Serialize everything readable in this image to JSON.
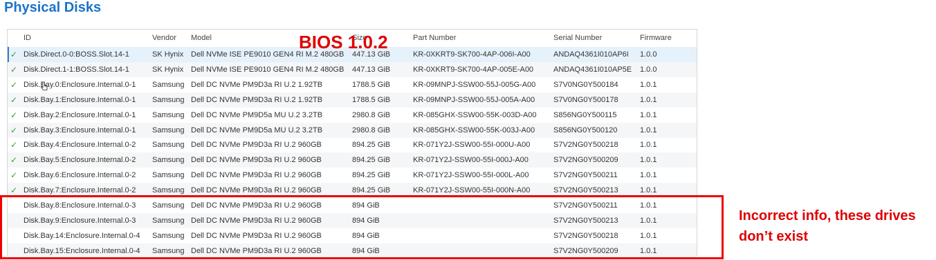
{
  "page": {
    "title": "Physical Disks"
  },
  "table": {
    "columns": [
      "ID",
      "Vendor",
      "Model",
      "Size",
      "Part Number",
      "Serial Number",
      "Firmware"
    ],
    "rows": [
      {
        "check": "✓",
        "id": "Disk.Direct.0-0:BOSS.Slot.14-1",
        "vendor": "SK Hynix",
        "model": "Dell NVMe ISE PE9010 GEN4 RI M.2 480GB",
        "size": "447.13 GiB",
        "part": "KR-0XKRT9-SK700-4AP-006I-A00",
        "serial": "ANDAQ4361I010AP6I",
        "firmware": "1.0.0"
      },
      {
        "check": "✓",
        "id": "Disk.Direct.1-1:BOSS.Slot.14-1",
        "vendor": "SK Hynix",
        "model": "Dell NVMe ISE PE9010 GEN4 RI M.2 480GB",
        "size": "447.13 GiB",
        "part": "KR-0XKRT9-SK700-4AP-005E-A00",
        "serial": "ANDAQ4361I010AP5E",
        "firmware": "1.0.0"
      },
      {
        "check": "✓",
        "id": "Disk.Bay.0:Enclosure.Internal.0-1",
        "vendor": "Samsung",
        "model": "Dell DC NVMe PM9D3a RI U.2 1.92TB",
        "size": "1788.5 GiB",
        "part": "KR-09MNPJ-SSW00-55J-005G-A00",
        "serial": "S7V0NG0Y500184",
        "firmware": "1.0.1"
      },
      {
        "check": "✓",
        "id": "Disk.Bay.1:Enclosure.Internal.0-1",
        "vendor": "Samsung",
        "model": "Dell DC NVMe PM9D3a RI U.2 1.92TB",
        "size": "1788.5 GiB",
        "part": "KR-09MNPJ-SSW00-55J-005A-A00",
        "serial": "S7V0NG0Y500178",
        "firmware": "1.0.1"
      },
      {
        "check": "✓",
        "id": "Disk.Bay.2:Enclosure.Internal.0-1",
        "vendor": "Samsung",
        "model": "Dell DC NVMe PM9D5a MU U.2 3.2TB",
        "size": "2980.8 GiB",
        "part": "KR-085GHX-SSW00-55K-003D-A00",
        "serial": "S856NG0Y500115",
        "firmware": "1.0.1"
      },
      {
        "check": "✓",
        "id": "Disk.Bay.3:Enclosure.Internal.0-1",
        "vendor": "Samsung",
        "model": "Dell DC NVMe PM9D5a MU U.2 3.2TB",
        "size": "2980.8 GiB",
        "part": "KR-085GHX-SSW00-55K-003J-A00",
        "serial": "S856NG0Y500120",
        "firmware": "1.0.1"
      },
      {
        "check": "✓",
        "id": "Disk.Bay.4:Enclosure.Internal.0-2",
        "vendor": "Samsung",
        "model": "Dell DC NVMe PM9D3a RI U.2 960GB",
        "size": "894.25 GiB",
        "part": "KR-071Y2J-SSW00-55I-000U-A00",
        "serial": "S7V2NG0Y500218",
        "firmware": "1.0.1"
      },
      {
        "check": "✓",
        "id": "Disk.Bay.5:Enclosure.Internal.0-2",
        "vendor": "Samsung",
        "model": "Dell DC NVMe PM9D3a RI U.2 960GB",
        "size": "894.25 GiB",
        "part": "KR-071Y2J-SSW00-55I-000J-A00",
        "serial": "S7V2NG0Y500209",
        "firmware": "1.0.1"
      },
      {
        "check": "✓",
        "id": "Disk.Bay.6:Enclosure.Internal.0-2",
        "vendor": "Samsung",
        "model": "Dell DC NVMe PM9D3a RI U.2 960GB",
        "size": "894.25 GiB",
        "part": "KR-071Y2J-SSW00-55I-000L-A00",
        "serial": "S7V2NG0Y500211",
        "firmware": "1.0.1"
      },
      {
        "check": "✓",
        "id": "Disk.Bay.7:Enclosure.Internal.0-2",
        "vendor": "Samsung",
        "model": "Dell DC NVMe PM9D3a RI U.2 960GB",
        "size": "894.25 GiB",
        "part": "KR-071Y2J-SSW00-55I-000N-A00",
        "serial": "S7V2NG0Y500213",
        "firmware": "1.0.1"
      },
      {
        "check": "",
        "id": "Disk.Bay.8:Enclosure.Internal.0-3",
        "vendor": "Samsung",
        "model": "Dell DC NVMe PM9D3a RI U.2 960GB",
        "size": "894 GiB",
        "part": "",
        "serial": "S7V2NG0Y500211",
        "firmware": "1.0.1"
      },
      {
        "check": "",
        "id": "Disk.Bay.9:Enclosure.Internal.0-3",
        "vendor": "Samsung",
        "model": "Dell DC NVMe PM9D3a RI U.2 960GB",
        "size": "894 GiB",
        "part": "",
        "serial": "S7V2NG0Y500213",
        "firmware": "1.0.1"
      },
      {
        "check": "",
        "id": "Disk.Bay.14:Enclosure.Internal.0-4",
        "vendor": "Samsung",
        "model": "Dell DC NVMe PM9D3a RI U.2 960GB",
        "size": "894 GiB",
        "part": "",
        "serial": "S7V2NG0Y500218",
        "firmware": "1.0.1"
      },
      {
        "check": "",
        "id": "Disk.Bay.15:Enclosure.Internal.0-4",
        "vendor": "Samsung",
        "model": "Dell DC NVMe PM9D3a RI U.2 960GB",
        "size": "894 GiB",
        "part": "",
        "serial": "S7V2NG0Y500209",
        "firmware": "1.0.1"
      }
    ]
  },
  "annotations": {
    "bios": "BIOS 1.0.2",
    "note_line1": "Incorrect info, these drives",
    "note_line2": "don’t exist"
  },
  "colors": {
    "title": "#1a73c8",
    "check": "#3a9a3a",
    "annotation": "#e00000",
    "selected_row": "#e6f2fb",
    "alt_row": "#f4f6f8"
  }
}
